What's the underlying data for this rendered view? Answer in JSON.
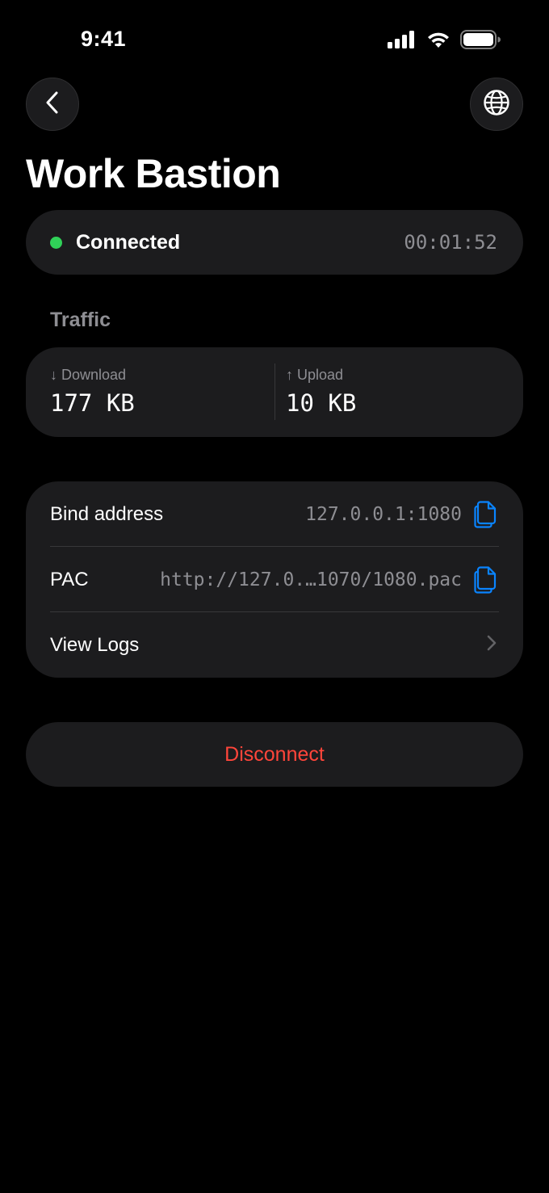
{
  "status_bar": {
    "time": "9:41"
  },
  "nav": {
    "back_icon": "chevron-left-icon",
    "globe_icon": "globe-icon"
  },
  "page": {
    "title": "Work Bastion"
  },
  "connection": {
    "status": "Connected",
    "elapsed": "00:01:52",
    "status_color": "#30d158"
  },
  "traffic": {
    "header": "Traffic",
    "download": {
      "arrow": "↓",
      "label": "Download",
      "value": "177 KB"
    },
    "upload": {
      "arrow": "↑",
      "label": "Upload",
      "value": "10 KB"
    }
  },
  "details": {
    "bind_address": {
      "label": "Bind address",
      "value": "127.0.0.1:1080"
    },
    "pac": {
      "label": "PAC",
      "value": "http://127.0.…1070/1080.pac"
    },
    "logs": {
      "label": "View Logs"
    }
  },
  "actions": {
    "disconnect_label": "Disconnect",
    "disconnect_color": "#ff453a"
  },
  "colors": {
    "accent": "#0a84ff",
    "background": "#000000",
    "card": "#1c1c1e",
    "secondary_text": "#8e8e93"
  }
}
